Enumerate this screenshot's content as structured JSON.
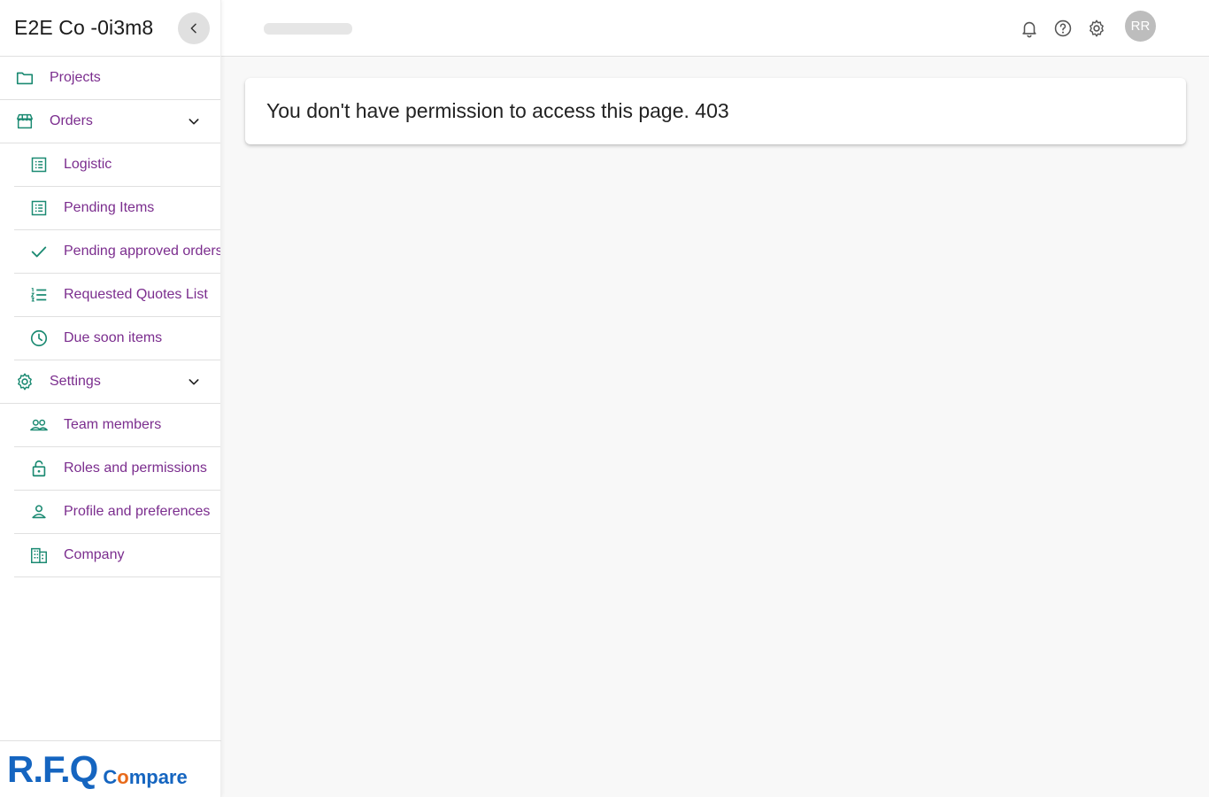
{
  "sidebar": {
    "company_name": "E2E Co -0i3m8",
    "items": [
      {
        "label": "Projects",
        "icon": "folder-icon"
      },
      {
        "label": "Orders",
        "icon": "store-icon"
      },
      {
        "label": "Logistic",
        "icon": "list-alt-icon"
      },
      {
        "label": "Pending Items",
        "icon": "list-alt-icon"
      },
      {
        "label": "Pending approved orders",
        "icon": "check-icon"
      },
      {
        "label": "Requested Quotes List",
        "icon": "format-list-numbered-icon"
      },
      {
        "label": "Due soon items",
        "icon": "clock-icon"
      },
      {
        "label": "Settings",
        "icon": "gear-icon"
      },
      {
        "label": "Team members",
        "icon": "people-icon"
      },
      {
        "label": "Roles and permissions",
        "icon": "lock-open-icon"
      },
      {
        "label": "Profile and preferences",
        "icon": "person-icon"
      },
      {
        "label": "Company",
        "icon": "business-icon"
      }
    ],
    "logo": {
      "rfq": "R.F.Q",
      "compare_pre": "C",
      "compare_o": "o",
      "compare_post": "mpare"
    }
  },
  "header": {
    "avatar_initials": "RR"
  },
  "main": {
    "error_message": "You don't have permission to access this page. 403"
  },
  "colors": {
    "icon_teal": "#1b8a72",
    "label_purple": "#7b2d8e",
    "logo_blue": "#1565c0",
    "logo_orange": "#e86a1a"
  }
}
